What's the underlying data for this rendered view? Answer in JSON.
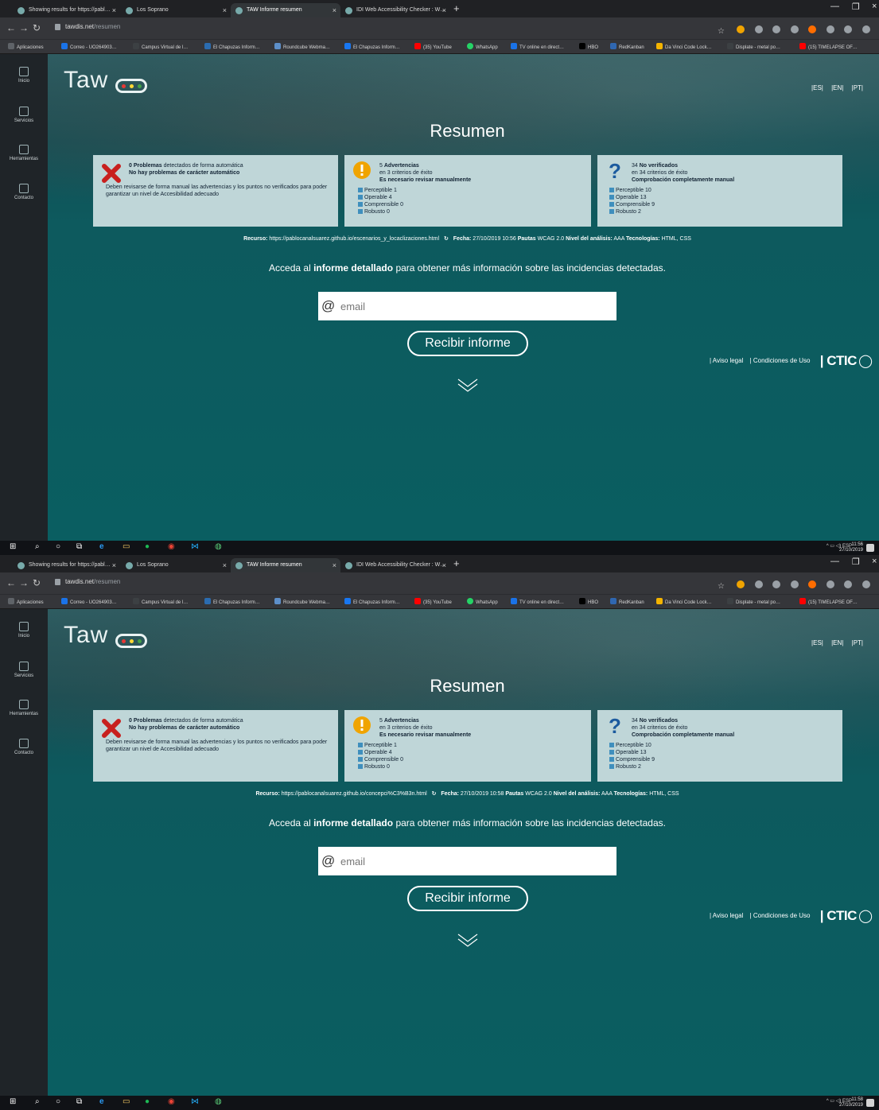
{
  "screens": [
    {
      "browser": {
        "tabs": [
          "Showing results for https://pabl…",
          "Los Soprano",
          "TAW Informe resumen",
          "IDI Web Accessibility Checker : W…"
        ],
        "url_host": "tawdis.net",
        "url_path": "/resumen",
        "bookmarks": [
          "Aplicaciones",
          "Correo - UO264903…",
          "Campus Virtual de l…",
          "El Chapuzas Inform…",
          "Roundcube Webma…",
          "El Chapuzas Inform…",
          "(35) YouTube",
          "WhatsApp",
          "TV online en direct…",
          "HBO",
          "RedKanban",
          "Da Vinci Code Lock…",
          "Displate - metal po…",
          "(15) TIMELAPSE OF…"
        ]
      },
      "sidebar": [
        "Inicio",
        "Servicios",
        "Herramientas",
        "Contacto"
      ],
      "logo": "Taw",
      "langs": [
        "|ES|",
        "|EN|",
        "|PT|"
      ],
      "title": "Resumen",
      "cards": {
        "problems": {
          "count": "0",
          "label": "Problemas",
          "detail": "detectados de forma automática",
          "bold_line": "No hay problemas de carácter automático",
          "note": "Deben revisarse de forma manual las advertencias y los puntos no verificados para poder garantizar un nivel de Accesibilidad adecuado"
        },
        "warnings": {
          "count": "5",
          "label": "Advertencias",
          "sub": "en 3 criterios de éxito",
          "bold_line": "Es necesario revisar manualmente",
          "items": [
            "Perceptible 1",
            "Operable 4",
            "Comprensible 0",
            "Robusto 0"
          ]
        },
        "unverified": {
          "count": "34",
          "label": "No verificados",
          "sub": "en 34 criterios de éxito",
          "bold_line": "Comprobación completamente manual",
          "items": [
            "Perceptible 10",
            "Operable 13",
            "Comprensible 9",
            "Robusto 2"
          ]
        }
      },
      "resource": {
        "label_recurso": "Recurso:",
        "url": "https://pablocanalsuarez.github.io/escenarios_y_locaclizaciones.html",
        "label_fecha": "Fecha:",
        "fecha": "27/10/2019 10:56",
        "label_pautas": "Pautas",
        "pautas": "WCAG 2.0",
        "label_nivel": "Nivel del análisis:",
        "nivel": "AAA",
        "label_tec": "Tecnologías:",
        "tec": "HTML, CSS"
      },
      "access": {
        "pre": "Acceda al",
        "bold": "informe detallado",
        "post": "para obtener más información sobre las incidencias detectadas."
      },
      "email_placeholder": "email",
      "button": "Recibir informe",
      "footer": {
        "legal": "| Aviso legal",
        "terms": "| Condiciones de Uso",
        "brand": "| CTIC"
      },
      "taskbar": {
        "lang": "ESP",
        "time": "11:56",
        "date": "27/10/2019"
      }
    },
    {
      "browser": {
        "tabs": [
          "Showing results for https://pabl…",
          "Los Soprano",
          "TAW Informe resumen",
          "IDI Web Accessibility Checker : W…"
        ],
        "url_host": "tawdis.net",
        "url_path": "/resumen",
        "bookmarks": [
          "Aplicaciones",
          "Correo - UO264903…",
          "Campus Virtual de l…",
          "El Chapuzas Inform…",
          "Roundcube Webma…",
          "El Chapuzas Inform…",
          "(35) YouTube",
          "WhatsApp",
          "TV online en direct…",
          "HBO",
          "RedKanban",
          "Da Vinci Code Lock…",
          "Displate - metal po…",
          "(15) TIMELAPSE OF…"
        ]
      },
      "sidebar": [
        "Inicio",
        "Servicios",
        "Herramientas",
        "Contacto"
      ],
      "logo": "Taw",
      "langs": [
        "|ES|",
        "|EN|",
        "|PT|"
      ],
      "title": "Resumen",
      "cards": {
        "problems": {
          "count": "0",
          "label": "Problemas",
          "detail": "detectados de forma automática",
          "bold_line": "No hay problemas de carácter automático",
          "note": "Deben revisarse de forma manual las advertencias y los puntos no verificados para poder garantizar un nivel de Accesibilidad adecuado"
        },
        "warnings": {
          "count": "5",
          "label": "Advertencias",
          "sub": "en 3 criterios de éxito",
          "bold_line": "Es necesario revisar manualmente",
          "items": [
            "Perceptible 1",
            "Operable 4",
            "Comprensible 0",
            "Robusto 0"
          ]
        },
        "unverified": {
          "count": "34",
          "label": "No verificados",
          "sub": "en 34 criterios de éxito",
          "bold_line": "Comprobación completamente manual",
          "items": [
            "Perceptible 10",
            "Operable 13",
            "Comprensible 9",
            "Robusto 2"
          ]
        }
      },
      "resource": {
        "label_recurso": "Recurso:",
        "url": "https://pablocanalsuarez.github.io/concepci%C3%B3n.html",
        "label_fecha": "Fecha:",
        "fecha": "27/10/2019 10:58",
        "label_pautas": "Pautas",
        "pautas": "WCAG 2.0",
        "label_nivel": "Nivel del análisis:",
        "nivel": "AAA",
        "label_tec": "Tecnologías:",
        "tec": "HTML, CSS"
      },
      "access": {
        "pre": "Acceda al",
        "bold": "informe detallado",
        "post": "para obtener más información sobre las incidencias detectadas."
      },
      "email_placeholder": "email",
      "button": "Recibir informe",
      "footer": {
        "legal": "| Aviso legal",
        "terms": "| Condiciones de Uso",
        "brand": "| CTIC"
      },
      "taskbar": {
        "lang": "ESP",
        "time": "11:58",
        "date": "27/10/2019"
      }
    }
  ],
  "colors": {
    "page_bg": "#0c5a5e",
    "card_bg": "#bfd6d8",
    "sidebar_bg": "#1f2428",
    "error_red": "#c8201e",
    "warning_orange": "#f0a400",
    "question_blue": "#1b5a9e"
  }
}
